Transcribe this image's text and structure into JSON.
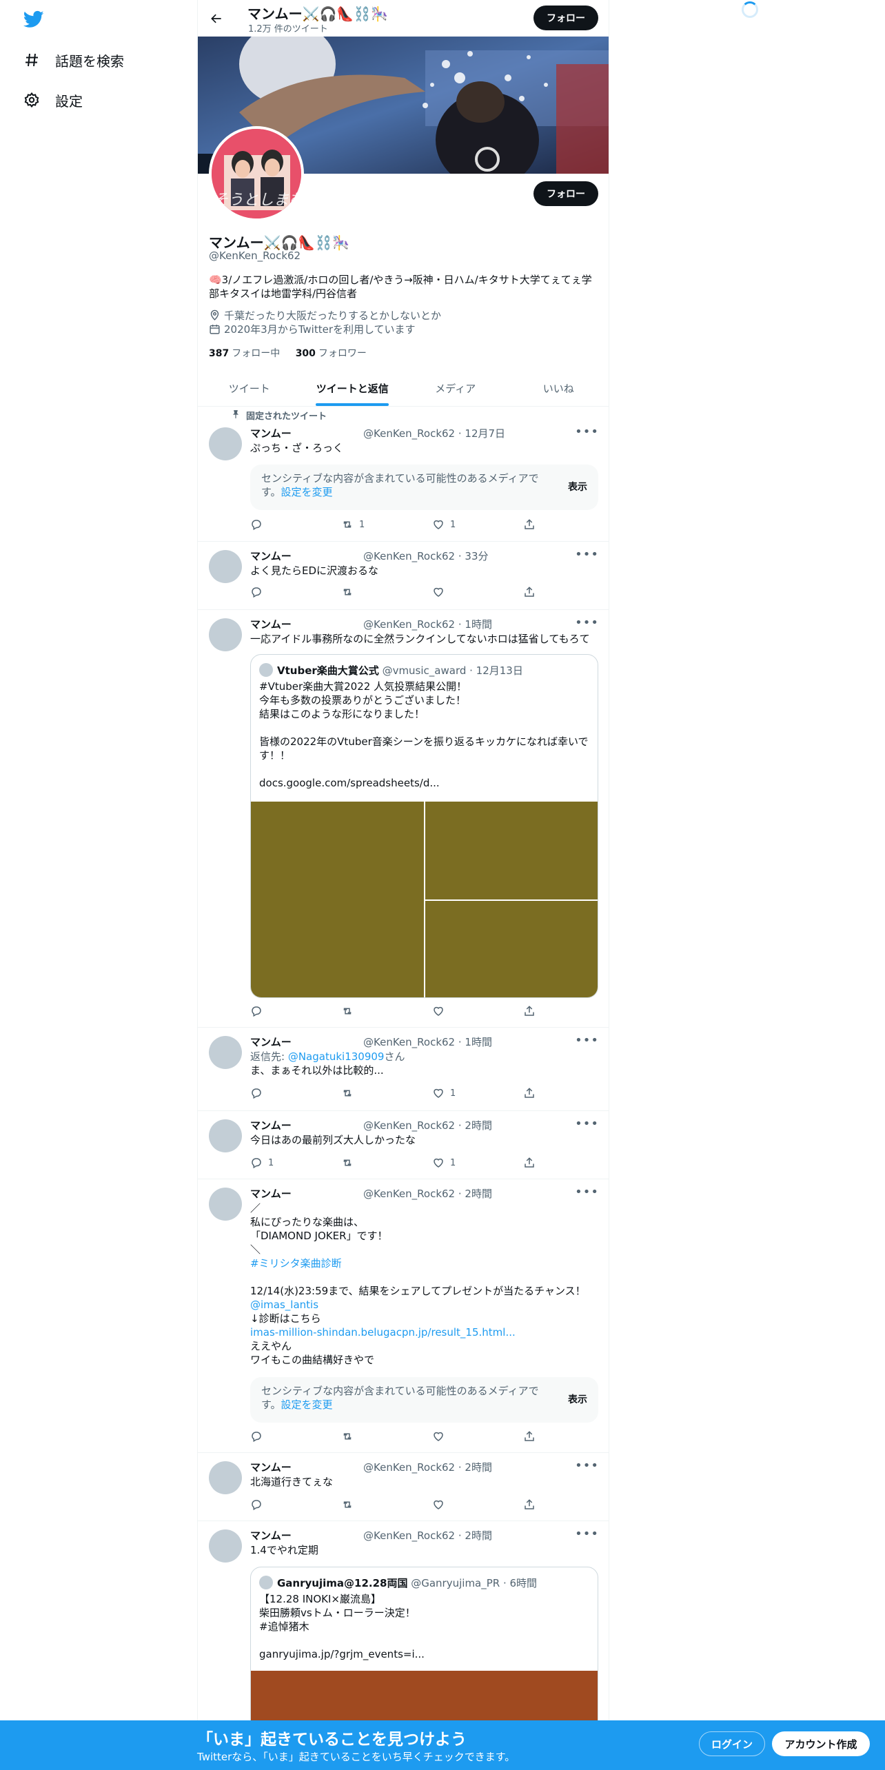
{
  "nav": {
    "explore_label": "話題を検索",
    "settings_label": "設定"
  },
  "header": {
    "name": "マンムー⚔️🎧👠⛓️🎠",
    "tweet_count": "1.2万 件のツイート",
    "follow_label": "フォロー"
  },
  "profile": {
    "name": "マンムー⚔️🎧👠⛓️🎠",
    "handle": "@KenKen_Rock62",
    "bio": "🧠3/ノエフレ過激派/ホロの回し者/やきう→阪神・日ハム/キタサト大学てぇてぇ学部キタスイは地雷学科/円谷信者",
    "location": "千葉だったり大阪だったりするとかしないとか",
    "joined": "2020年3月からTwitterを利用しています",
    "following_count": "387",
    "following_label": "フォロー中",
    "followers_count": "300",
    "followers_label": "フォロワー",
    "follow_label": "フォロー",
    "avatar_caption": "そうとしまむ"
  },
  "tabs": [
    "ツイート",
    "ツイートと返信",
    "メディア",
    "いいね"
  ],
  "pinned_label": "固定されたツイート",
  "tweets": [
    {
      "name": "マンムー",
      "meta": "@KenKen_Rock62 · 12月7日",
      "text": "ぷっち・ざ・ろっく",
      "reply": "",
      "retweet": "1",
      "like": "1"
    },
    {
      "name": "マンムー",
      "meta": "@KenKen_Rock62 · 33分",
      "text": "よく見たらEDに沢渡おるな",
      "reply": "",
      "retweet": "",
      "like": ""
    },
    {
      "name": "マンムー",
      "meta": "@KenKen_Rock62 · 1時間",
      "text": "一応アイドル事務所なのに全然ランクインしてないホロは猛省してもろて",
      "reply": "",
      "retweet": "",
      "like": "",
      "quote": {
        "name": "Vtuber楽曲大賞公式",
        "meta": "@vmusic_award · 12月13日",
        "text": "#Vtuber楽曲大賞2022 人気投票結果公開！\n今年も多数の投票ありがとうございました！\n結果はこのような形になりました！\n\n皆様の2022年のVtuber音楽シーンを振り返るキッカケになれば幸いです！！\n\ndocs.google.com/spreadsheets/d..."
      }
    },
    {
      "name": "マンムー",
      "meta": "@KenKen_Rock62 · 1時間",
      "reply_prefix": "返信先: ",
      "reply_to": "@Nagatuki130909",
      "reply_suffix": "さん",
      "text": "ま、まぁそれ以外は比較的...",
      "reply": "",
      "retweet": "",
      "like": "1"
    },
    {
      "name": "マンムー",
      "meta": "@KenKen_Rock62 · 2時間",
      "text": "今日はあの最前列ズ大人しかったな",
      "reply": "1",
      "retweet": "",
      "like": "1"
    },
    {
      "name": "マンムー",
      "meta": "@KenKen_Rock62 · 2時間",
      "line1": "／\n私にぴったりな楽曲は、\n「DIAMOND JOKER」です！\n＼",
      "hashtag": "#ミリシタ楽曲診断",
      "line2": "12/14(水)23:59まで、結果をシェアしてプレゼントが当たるチャンス！",
      "mention": "@imas_lantis",
      "line3": "↓診断はこちら",
      "url": "imas-million-shindan.belugacpn.jp/result_15.html...",
      "line4": "ええやん\nワイもこの曲結構好きやで",
      "reply": "",
      "retweet": "",
      "like": ""
    },
    {
      "name": "マンムー",
      "meta": "@KenKen_Rock62 · 2時間",
      "text": "北海道行きてぇな",
      "reply": "",
      "retweet": "",
      "like": ""
    },
    {
      "name": "マンムー",
      "meta": "@KenKen_Rock62 · 2時間",
      "text": "1.4でやれ定期",
      "quote": {
        "name": "Ganryujima@12.28両国",
        "meta": "@Ganryujima_PR · 6時間",
        "text": "【12.28 INOKI×巌流島】\n柴田勝頼vsトム・ローラー決定！\n#追悼猪木\n\nganryujima.jp/?grjm_events=i..."
      }
    }
  ],
  "sensitive": {
    "text": "センシティブな内容が含まれている可能性のあるメディアです。",
    "link": "設定を変更",
    "button": "表示"
  },
  "bottom_bar": {
    "title": "「いま」起きていることを見つけよう",
    "subtitle": "Twitterなら、「いま」起きていることをいち早くチェックできます。",
    "login": "ログイン",
    "signup": "アカウント作成"
  },
  "colors": {
    "accent": "#1d9bf0",
    "media_olive": "#7b6d22",
    "media_brown": "#a04a20"
  }
}
